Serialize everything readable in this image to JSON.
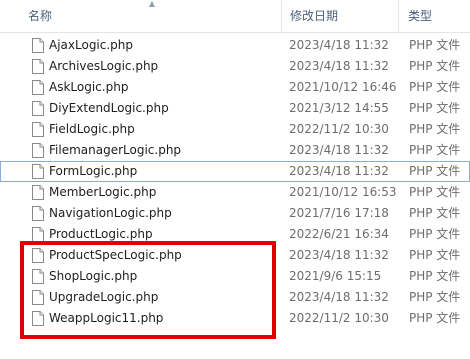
{
  "columns": {
    "name": "名称",
    "date": "修改日期",
    "type": "类型"
  },
  "files": [
    {
      "name": "AjaxLogic.php",
      "date": "2023/4/18 11:32",
      "type": "PHP 文件"
    },
    {
      "name": "ArchivesLogic.php",
      "date": "2023/4/18 11:32",
      "type": "PHP 文件"
    },
    {
      "name": "AskLogic.php",
      "date": "2021/10/12 16:46",
      "type": "PHP 文件"
    },
    {
      "name": "DiyExtendLogic.php",
      "date": "2021/3/12 14:55",
      "type": "PHP 文件"
    },
    {
      "name": "FieldLogic.php",
      "date": "2022/11/2 10:30",
      "type": "PHP 文件"
    },
    {
      "name": "FilemanagerLogic.php",
      "date": "2023/4/18 11:32",
      "type": "PHP 文件"
    },
    {
      "name": "FormLogic.php",
      "date": "2023/4/18 11:32",
      "type": "PHP 文件"
    },
    {
      "name": "MemberLogic.php",
      "date": "2021/10/12 16:53",
      "type": "PHP 文件"
    },
    {
      "name": "NavigationLogic.php",
      "date": "2021/7/16 17:18",
      "type": "PHP 文件"
    },
    {
      "name": "ProductLogic.php",
      "date": "2022/6/21 16:34",
      "type": "PHP 文件"
    },
    {
      "name": "ProductSpecLogic.php",
      "date": "2023/4/18 11:32",
      "type": "PHP 文件"
    },
    {
      "name": "ShopLogic.php",
      "date": "2021/9/6 15:15",
      "type": "PHP 文件"
    },
    {
      "name": "UpgradeLogic.php",
      "date": "2023/4/18 11:32",
      "type": "PHP 文件"
    },
    {
      "name": "WeappLogic11.php",
      "date": "2022/11/2 10:30",
      "type": "PHP 文件"
    }
  ],
  "icons": {
    "sort": "sort-up-icon",
    "file": "file-icon"
  },
  "colors": {
    "highlight": "#e00000",
    "focus_outline": "#8dabd8",
    "header_text": "#4c607a"
  }
}
